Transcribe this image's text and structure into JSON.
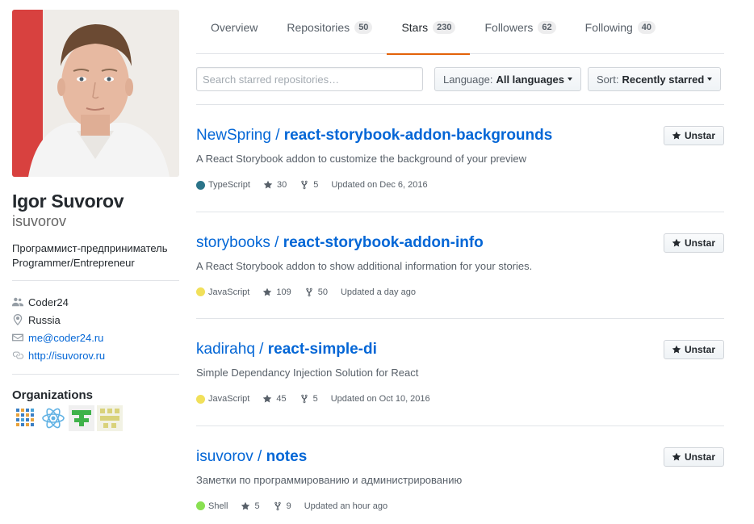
{
  "profile": {
    "fullname": "Igor Suvorov",
    "username": "isuvorov",
    "bio_line1": "Программист-предприниматель",
    "bio_line2": "Programmer/Entrepreneur",
    "company": "Coder24",
    "location": "Russia",
    "email": "me@coder24.ru",
    "website": "http://isuvorov.ru",
    "organizations_heading": "Organizations"
  },
  "icons": {
    "company": "people-icon",
    "location": "location-pin-icon",
    "email": "mail-icon",
    "website": "link-icon",
    "star": "star-icon",
    "fork": "fork-icon"
  },
  "tabs": [
    {
      "label": "Overview",
      "count": ""
    },
    {
      "label": "Repositories",
      "count": "50"
    },
    {
      "label": "Stars",
      "count": "230",
      "selected": true
    },
    {
      "label": "Followers",
      "count": "62"
    },
    {
      "label": "Following",
      "count": "40"
    }
  ],
  "filters": {
    "search_placeholder": "Search starred repositories…",
    "language_label": "Language:",
    "language_value": "All languages",
    "sort_label": "Sort:",
    "sort_value": "Recently starred"
  },
  "colors": {
    "accent_tab": "#e36209",
    "link": "#0366d6",
    "typescript": "#2b7489",
    "javascript": "#f1e05a",
    "shell": "#89e051"
  },
  "unstar_label": "Unstar",
  "repos": [
    {
      "owner": "NewSpring",
      "name": "react-storybook-addon-backgrounds",
      "description": "A React Storybook addon to customize the background of your preview",
      "language": "TypeScript",
      "language_color": "#2b7489",
      "stars": "30",
      "forks": "5",
      "updated": "Updated on Dec 6, 2016"
    },
    {
      "owner": "storybooks",
      "name": "react-storybook-addon-info",
      "description": "A React Storybook addon to show additional information for your stories.",
      "language": "JavaScript",
      "language_color": "#f1e05a",
      "stars": "109",
      "forks": "50",
      "updated": "Updated a day ago"
    },
    {
      "owner": "kadirahq",
      "name": "react-simple-di",
      "description": "Simple Dependancy Injection Solution for React",
      "language": "JavaScript",
      "language_color": "#f1e05a",
      "stars": "45",
      "forks": "5",
      "updated": "Updated on Oct 10, 2016"
    },
    {
      "owner": "isuvorov",
      "name": "notes",
      "description": "Заметки по программированию и администрированию",
      "language": "Shell",
      "language_color": "#89e051",
      "stars": "5",
      "forks": "9",
      "updated": "Updated an hour ago"
    }
  ]
}
